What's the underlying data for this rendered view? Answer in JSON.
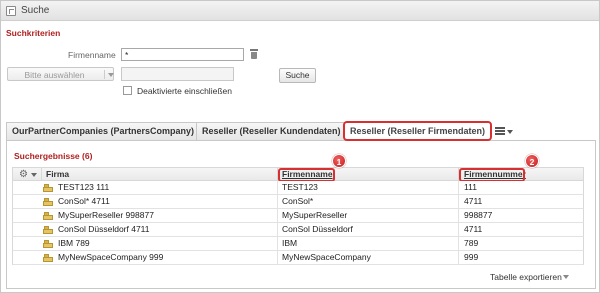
{
  "window": {
    "title": "Suche"
  },
  "search": {
    "section_title": "Suchkriterien",
    "firmenname_label": "Firmenname",
    "firmenname_value": "*",
    "select_placeholder": "Bitte auswählen",
    "search_button": "Suche",
    "checkbox_label": "Deaktivierte einschließen"
  },
  "tabs": [
    {
      "label": "OurPartnerCompanies (PartnersCompany)"
    },
    {
      "label": "Reseller (Reseller Kundendaten)"
    },
    {
      "label": "Reseller (Reseller Firmendaten)",
      "active": true
    }
  ],
  "results": {
    "title": "Suchergebnisse (6)",
    "columns": {
      "firma": "Firma",
      "firmenname": "Firmenname",
      "firmennummer": "Firmennummer"
    },
    "badges": [
      "1",
      "2"
    ],
    "rows": [
      {
        "firma": "TEST123 111",
        "firmenname": "TEST123",
        "firmennummer": "111"
      },
      {
        "firma": "ConSol* 4711",
        "firmenname": "ConSol*",
        "firmennummer": "4711"
      },
      {
        "firma": "MySuperReseller 998877",
        "firmenname": "MySuperReseller",
        "firmennummer": "998877"
      },
      {
        "firma": "ConSol Düsseldorf 4711",
        "firmenname": "ConSol Düsseldorf",
        "firmennummer": "4711"
      },
      {
        "firma": "IBM 789",
        "firmenname": "IBM",
        "firmennummer": "789"
      },
      {
        "firma": "MyNewSpaceCompany 999",
        "firmenname": "MyNewSpaceCompany",
        "firmennummer": "999"
      }
    ],
    "export_label": "Tabelle exportieren"
  },
  "colors": {
    "accent_red": "#d83030",
    "section_title": "#b02020"
  }
}
